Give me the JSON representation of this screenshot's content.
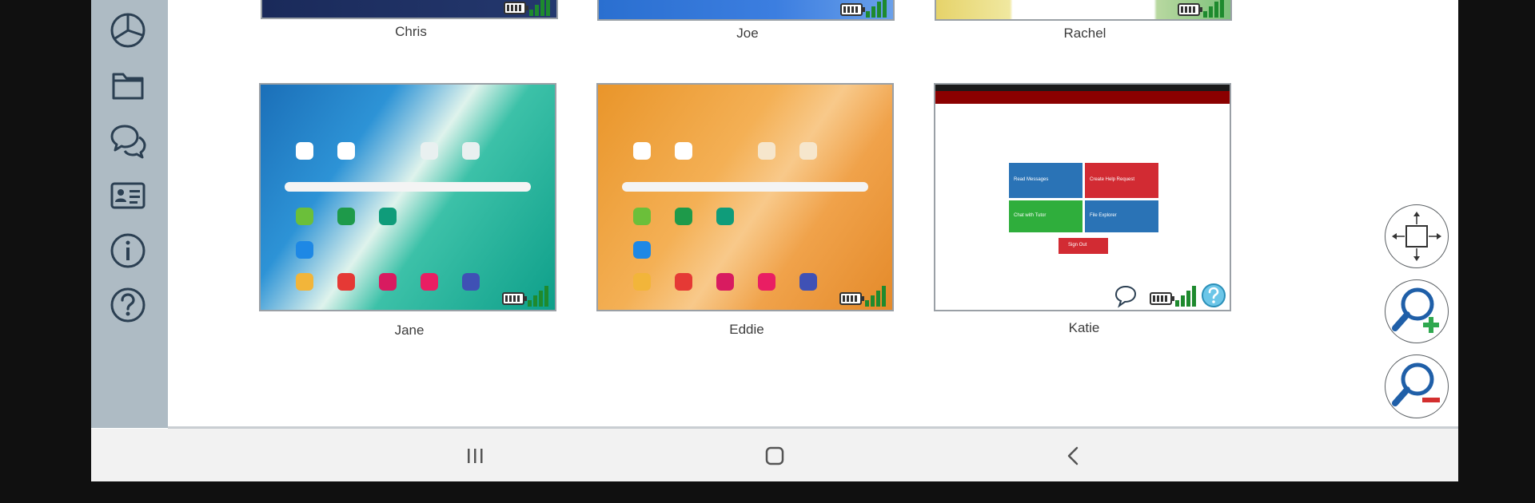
{
  "devices_top": [
    {
      "name": "Chris"
    },
    {
      "name": "Joe"
    },
    {
      "name": "Rachel"
    }
  ],
  "devices": [
    {
      "name": "Jane",
      "wallpaper": "teal"
    },
    {
      "name": "Eddie",
      "wallpaper": "orange"
    },
    {
      "name": "Katie",
      "wallpaper": "app"
    }
  ],
  "katie_screen": {
    "tiles": [
      {
        "label": "Read Messages",
        "color": "#2a73b6"
      },
      {
        "label": "Create Help Request",
        "color": "#d22b33"
      },
      {
        "label": "Chat with Tutor",
        "color": "#2fae3c"
      },
      {
        "label": "File Explorer",
        "color": "#2a73b6"
      }
    ],
    "signout_label": "Sign Out",
    "header_color": "#8b0000"
  },
  "sidebar": {
    "items": [
      {
        "icon": "pie-chart-icon"
      },
      {
        "icon": "folder-icon"
      },
      {
        "icon": "chat-bubbles-icon"
      },
      {
        "icon": "id-card-icon"
      },
      {
        "icon": "info-icon"
      },
      {
        "icon": "help-icon"
      }
    ]
  },
  "colors": {
    "sidebar": "#aebbc4",
    "signal": "#1e8a2e",
    "zoom_in": "#2fa84f",
    "zoom_out": "#d32f2f",
    "icon_stroke": "#2b3f52"
  }
}
